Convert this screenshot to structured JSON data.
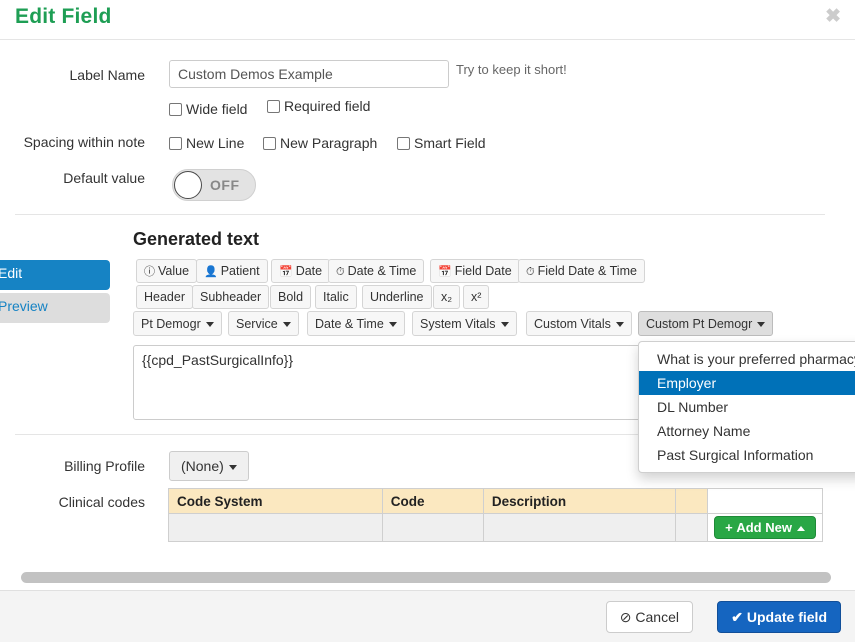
{
  "header": {
    "title": "Edit Field",
    "close_icon": "close-icon",
    "close_label": "✖"
  },
  "form": {
    "label_name": {
      "label": "Label Name",
      "value": "Custom Demos Example",
      "placeholder": "",
      "hint": "Try to keep it short!"
    },
    "field_options": [
      {
        "label": "Wide field",
        "checked": false
      },
      {
        "label": "Required field",
        "checked": false
      }
    ],
    "spacing": {
      "label": "Spacing within note",
      "options": [
        {
          "label": "New Line",
          "checked": false
        },
        {
          "label": "New Paragraph",
          "checked": false
        },
        {
          "label": "Smart Field",
          "checked": false
        }
      ]
    },
    "default_value": {
      "label": "Default value",
      "state": "OFF"
    }
  },
  "side_tabs": [
    {
      "label": "Edit",
      "active": true
    },
    {
      "label": "Preview",
      "active": false
    }
  ],
  "generated_text": {
    "title": "Generated text",
    "row1": [
      {
        "label": "Value",
        "icon": "info-icon",
        "glyph": "ℹ"
      },
      {
        "label": "Patient",
        "icon": "person-icon",
        "glyph": "♟"
      },
      {
        "label": "Date",
        "icon": "calendar-icon",
        "glyph": "Ὄ5"
      },
      {
        "label": "Date & Time",
        "icon": "clock-icon",
        "glyph": "◴"
      },
      {
        "label": "Field Date",
        "icon": "calendar-icon",
        "glyph": "Ὄ5"
      },
      {
        "label": "Field Date & Time",
        "icon": "clock-icon",
        "glyph": "◴"
      }
    ],
    "row2": [
      {
        "label": "Header"
      },
      {
        "label": "Subheader"
      },
      {
        "label": "Bold"
      },
      {
        "label": "Italic"
      },
      {
        "label": "Underline"
      },
      {
        "label": "x₂"
      },
      {
        "label": "x²"
      }
    ],
    "row3": [
      {
        "label": "Pt Demogr",
        "pressed": false
      },
      {
        "label": "Service",
        "pressed": false
      },
      {
        "label": "Date & Time",
        "pressed": false
      },
      {
        "label": "System Vitals",
        "pressed": false
      },
      {
        "label": "Custom Vitals",
        "pressed": false
      },
      {
        "label": "Custom Pt Demogr",
        "pressed": true
      }
    ],
    "textarea_value": "{{cpd_PastSurgicalInfo}}",
    "textarea_placeholder": ""
  },
  "dropdown": {
    "items": [
      {
        "label": "What is your preferred pharmacy?",
        "selected": false
      },
      {
        "label": "Employer",
        "selected": true
      },
      {
        "label": "DL Number",
        "selected": false
      },
      {
        "label": "Attorney Name",
        "selected": false
      },
      {
        "label": "Past Surgical Information",
        "selected": false
      }
    ]
  },
  "billing": {
    "label": "Billing Profile",
    "value": "(None)"
  },
  "clinical_codes": {
    "label": "Clinical codes",
    "columns": [
      "Code System",
      "Code",
      "Description",
      "",
      ""
    ],
    "rows": [],
    "add_new_label": "Add New",
    "add_new_plus": "+"
  },
  "footer": {
    "cancel_label": "Cancel",
    "cancel_glyph": "⊘",
    "update_label": "Update field",
    "update_glyph": "✔"
  },
  "colors": {
    "title_green": "#1e9e54",
    "tab_blue": "#1683c4",
    "dropdown_selected": "#0071b8",
    "primary_button": "#1565c0",
    "add_new_green": "#29a745",
    "table_header": "#fbe8c0"
  }
}
